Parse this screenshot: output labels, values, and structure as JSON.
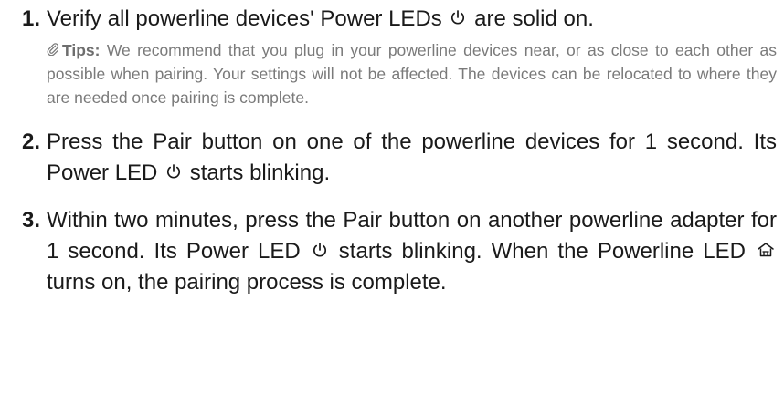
{
  "steps": [
    {
      "number": "1.",
      "text_before_icon": "Verify all powerline devices' Power LEDs ",
      "icon": "power-icon",
      "text_after_icon": " are solid on.",
      "tips": {
        "icon": "paperclip-icon",
        "label": "Tips:",
        "text": " We recommend that you plug in your powerline devices near, or as close to each other as possible when pairing. Your settings will not be affected. The devices can be relocated to where they are needed once pairing is complete."
      }
    },
    {
      "number": "2.",
      "text_before_icon": "Press the Pair button on one of the powerline devices for 1 second. Its Power LED ",
      "icon": "power-icon",
      "text_after_icon": " starts blinking."
    },
    {
      "number": "3.",
      "text_before_icon": "Within two minutes, press the Pair button on another powerline adapter for 1 second. Its Power LED ",
      "icon": "power-icon",
      "text_mid": " starts blinking. When the Powerline LED ",
      "icon2": "house-icon",
      "text_after_icon": " turns on, the pairing process is complete."
    }
  ],
  "colors": {
    "body_text": "#1a1a1a",
    "tips_text": "#7a7a7a"
  }
}
